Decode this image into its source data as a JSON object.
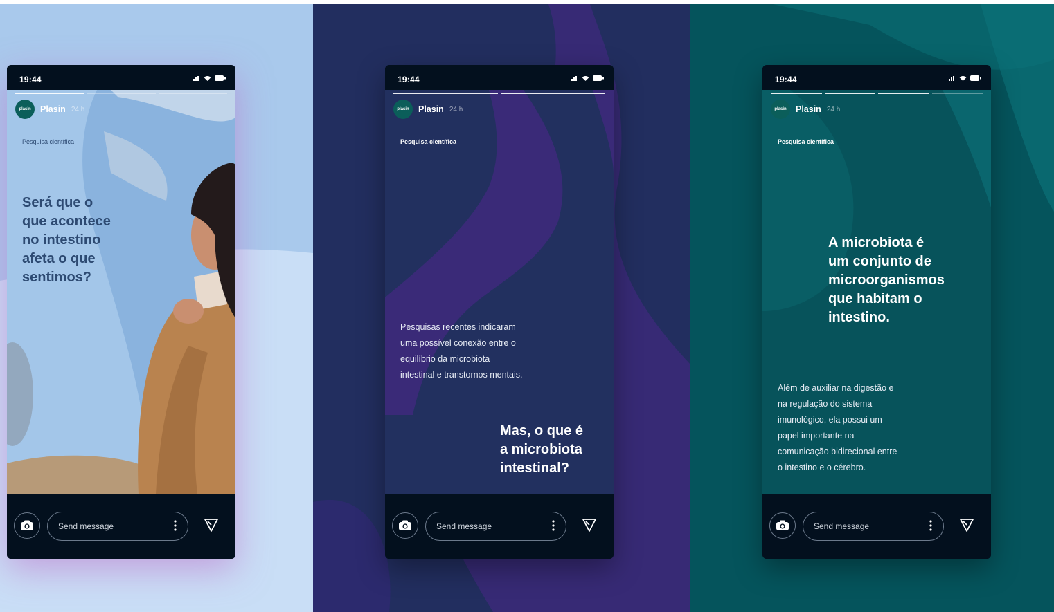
{
  "colors": {
    "panel1_bg": "#a9c9ec",
    "panel2_bg": "#222e5f",
    "panel3_bg": "#05545c",
    "accent_purple": "#3a2a78",
    "headline_dark": "#2d4a72",
    "phone_frame": "#03101e"
  },
  "stories": [
    {
      "time": "19:44",
      "username": "Plasin",
      "age": "24 h",
      "avatar_text": "plasin",
      "tag": "Pesquisa científica",
      "headline": [
        "Será que o",
        "que acontece",
        "no intestino",
        "afeta o que",
        "sentimos?"
      ],
      "reply_placeholder": "Send message"
    },
    {
      "time": "19:44",
      "username": "Plasin",
      "age": "24 h",
      "avatar_text": "plasin",
      "tag": "Pesquisa científica",
      "body": [
        "Pesquisas recentes indicaram",
        "uma possível conexão entre o",
        "equilíbrio da microbiota",
        "intestinal e transtornos mentais."
      ],
      "headline": [
        "Mas, o que é",
        "a microbiota",
        "intestinal?"
      ],
      "reply_placeholder": "Send message"
    },
    {
      "time": "19:44",
      "username": "Plasin",
      "age": "24 h",
      "avatar_text": "plasin",
      "tag": "Pesquisa científica",
      "headline": [
        "A microbiota é",
        "um conjunto de",
        "microorganismos",
        "que habitam o",
        "intestino."
      ],
      "body": [
        "Além de auxiliar na digestão e",
        "na regulação do sistema",
        "imunológico, ela possui um",
        "papel importante na",
        "comunicação bidirecional entre",
        "o intestino e o cérebro."
      ],
      "reply_placeholder": "Send message"
    }
  ],
  "icons": {
    "camera": "camera-icon",
    "more": "more-vertical-icon",
    "send": "send-icon",
    "signal": "signal-icon",
    "wifi": "wifi-icon",
    "battery": "battery-icon",
    "location": "location-arrow-icon"
  }
}
